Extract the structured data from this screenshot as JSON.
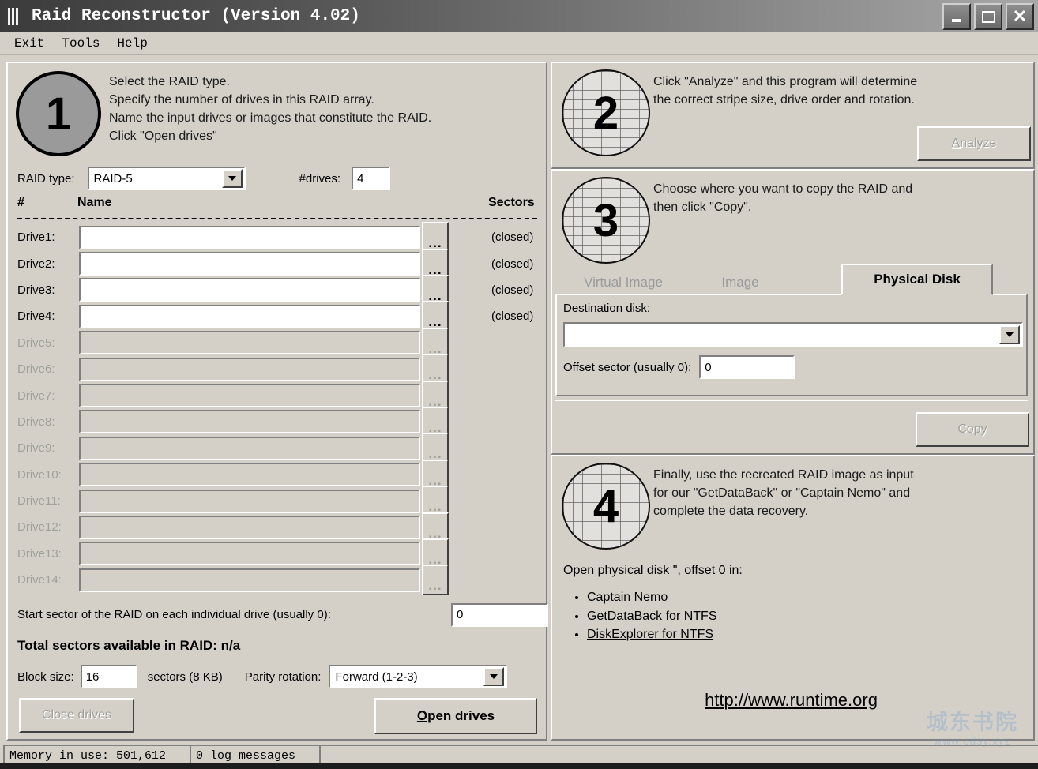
{
  "window": {
    "title": "Raid Reconstructor (Version 4.02)",
    "minimize_label": "_",
    "maximize_label": "□",
    "close_label": "×"
  },
  "menu": {
    "items": [
      "Exit",
      "Tools",
      "Help"
    ]
  },
  "step1": {
    "number": "1",
    "lines": [
      "Select the RAID type.",
      "Specify the number of drives in this RAID array.",
      "Name the input drives or images that constitute the RAID.",
      "Click \"Open drives\""
    ],
    "raid_type_label": "RAID type:",
    "raid_type_value": "RAID-5",
    "drives_count_label": "#drives:",
    "drives_count_value": "4",
    "col_num": "#",
    "col_name": "Name",
    "col_sectors": "Sectors",
    "drives": [
      {
        "label": "Drive1:",
        "value": "",
        "status": "(closed)",
        "enabled": true
      },
      {
        "label": "Drive2:",
        "value": "",
        "status": "(closed)",
        "enabled": true
      },
      {
        "label": "Drive3:",
        "value": "",
        "status": "(closed)",
        "enabled": true
      },
      {
        "label": "Drive4:",
        "value": "",
        "status": "(closed)",
        "enabled": true
      },
      {
        "label": "Drive5:",
        "value": "",
        "status": "",
        "enabled": false
      },
      {
        "label": "Drive6:",
        "value": "",
        "status": "",
        "enabled": false
      },
      {
        "label": "Drive7:",
        "value": "",
        "status": "",
        "enabled": false
      },
      {
        "label": "Drive8:",
        "value": "",
        "status": "",
        "enabled": false
      },
      {
        "label": "Drive9:",
        "value": "",
        "status": "",
        "enabled": false
      },
      {
        "label": "Drive10:",
        "value": "",
        "status": "",
        "enabled": false
      },
      {
        "label": "Drive11:",
        "value": "",
        "status": "",
        "enabled": false
      },
      {
        "label": "Drive12:",
        "value": "",
        "status": "",
        "enabled": false
      },
      {
        "label": "Drive13:",
        "value": "",
        "status": "",
        "enabled": false
      },
      {
        "label": "Drive14:",
        "value": "",
        "status": "",
        "enabled": false
      }
    ],
    "browse_button_label": "...",
    "start_sector_label": "Start sector of the RAID on each individual drive (usually 0):",
    "start_sector_value": "0",
    "total_sectors_label": "Total sectors available in RAID:  n/a",
    "block_size_label": "Block size:",
    "block_size_value": "16",
    "block_size_units": "sectors (8 KB)",
    "parity_label": "Parity rotation:",
    "parity_value": "Forward (1-2-3)",
    "close_drives_label": "Close drives",
    "open_drives_prefix": "O",
    "open_drives_rest": "pen drives"
  },
  "step2": {
    "number": "2",
    "lines": [
      "Click \"Analyze\" and this program will determine",
      "the correct stripe size, drive order and rotation."
    ],
    "analyze_prefix": "A",
    "analyze_rest": "nalyze"
  },
  "step3": {
    "number": "3",
    "lines": [
      "Choose where you want to copy the RAID and",
      "then click \"Copy\"."
    ],
    "tabs": [
      {
        "label": "Virtual Image",
        "active": false
      },
      {
        "label": "Image",
        "active": false
      },
      {
        "label": "Physical Disk",
        "active": true
      }
    ],
    "destination_label": "Destination disk:",
    "destination_value": "",
    "offset_label": "Offset sector (usually 0):",
    "offset_value": "0",
    "copy_label": "Copy"
  },
  "step4": {
    "number": "4",
    "lines": [
      "Finally, use the recreated RAID image as input",
      "for our \"GetDataBack\" or \"Captain Nemo\" and",
      "complete the data recovery."
    ],
    "open_line": "Open physical disk \", offset 0 in:",
    "links": [
      "Captain Nemo",
      "GetDataBack for NTFS",
      "DiskExplorer for NTFS"
    ],
    "url": "http://www.runtime.org"
  },
  "statusbar": {
    "memory": "Memory in use: 501,612",
    "log": "0 log messages",
    "blank": ""
  },
  "watermark": {
    "line1": "城东书院",
    "line2": "www.cdsy.xyz"
  },
  "colors": {
    "face": "#d4d0c8",
    "title_dark": "#3b3b3b",
    "title_light": "#a8a8a8",
    "disabled_text": "#a0a09a",
    "circle1_fill": "#9a9a9a"
  }
}
